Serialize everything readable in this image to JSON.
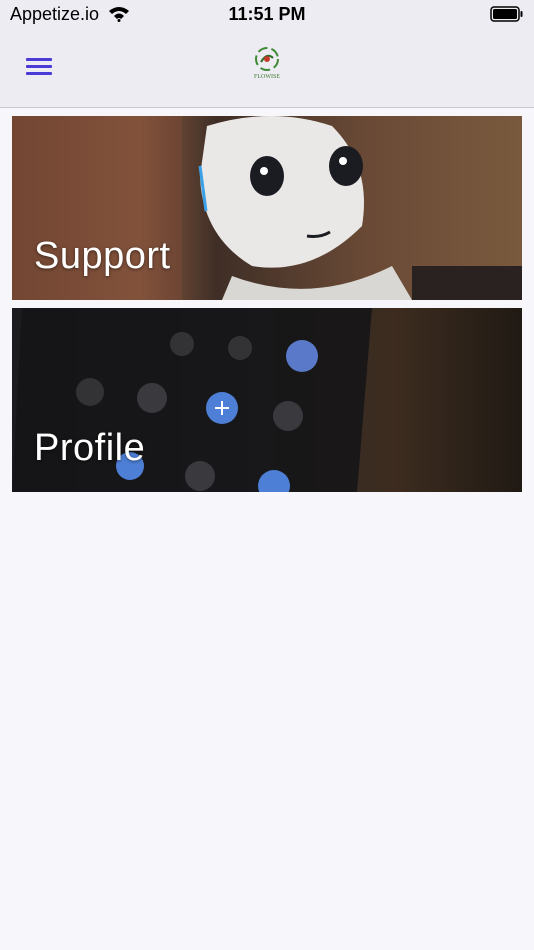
{
  "status_bar": {
    "carrier": "Appetize.io",
    "time": "11:51 PM",
    "icons": [
      "wifi-icon",
      "battery-icon"
    ]
  },
  "navbar": {
    "menu_icon": "hamburger-menu-icon",
    "logo_text": "FLOWISE"
  },
  "cards": [
    {
      "label": "Support"
    },
    {
      "label": "Profile"
    }
  ],
  "colors": {
    "accent": "#4b3bd6",
    "background": "#f7f6fb",
    "navbar": "#edecf3"
  }
}
